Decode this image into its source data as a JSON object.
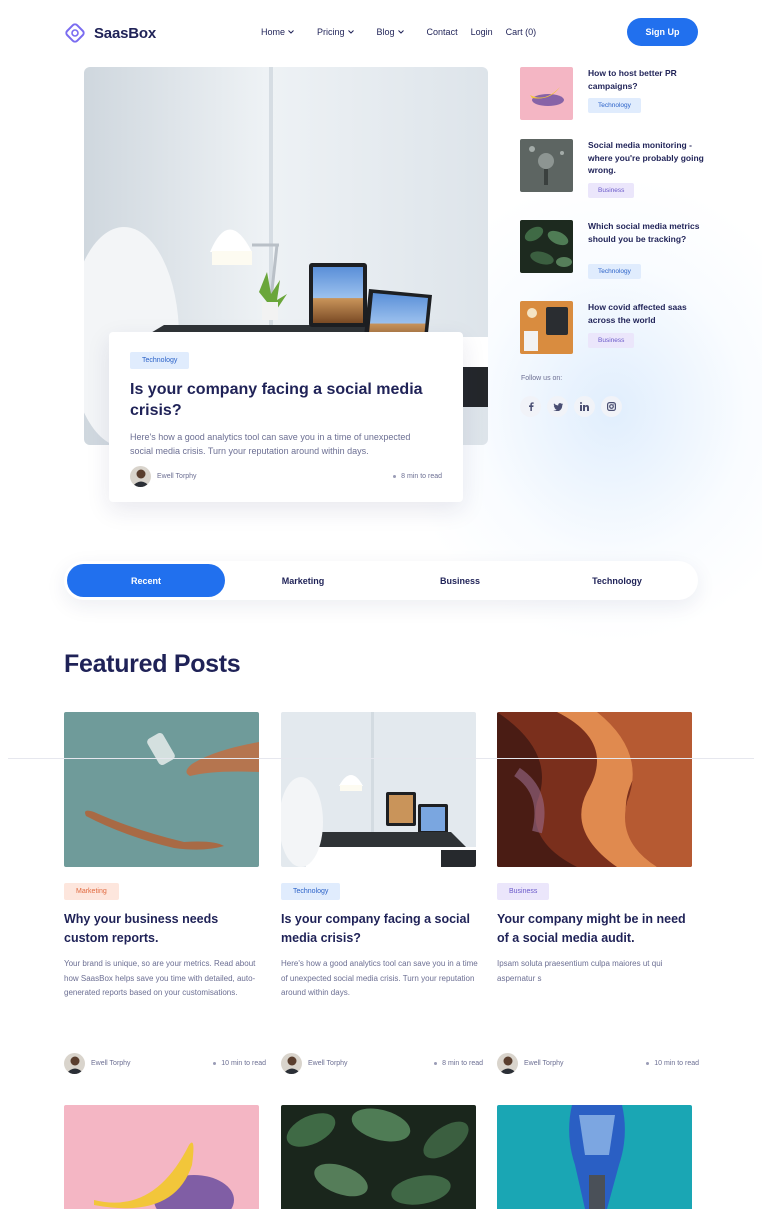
{
  "brand": {
    "name": "SaasBox",
    "accent": "#2170ee",
    "ink": "#1f2257"
  },
  "nav": {
    "items": [
      {
        "label": "Home",
        "has_dropdown": true
      },
      {
        "label": "Pricing",
        "has_dropdown": true
      },
      {
        "label": "Blog",
        "has_dropdown": true
      },
      {
        "label": "Contact",
        "has_dropdown": false
      },
      {
        "label": "Login",
        "has_dropdown": false
      },
      {
        "label": "Cart (0)",
        "has_dropdown": false
      }
    ],
    "cta": "Sign Up"
  },
  "hero": {
    "tag": "Technology",
    "title": "Is your company facing a social media crisis?",
    "description": "Here's how a good analytics tool can save you in a time of unexpected social media crisis. Turn your reputation around within days.",
    "author": "Ewell Torphy",
    "read_time": "8 min to read"
  },
  "sidebar": {
    "posts": [
      {
        "title": "How to host better PR campaigns?",
        "tag": "Technology",
        "tag_kind": "tech"
      },
      {
        "title": "Social media monitoring - where you're probably going wrong.",
        "tag": "Business",
        "tag_kind": "biz"
      },
      {
        "title": "Which social media metrics should you be tracking?",
        "tag": "Technology",
        "tag_kind": "tech"
      },
      {
        "title": "How covid affected saas across the world",
        "tag": "Business",
        "tag_kind": "biz"
      }
    ],
    "follow_label": "Follow us on:",
    "socials": [
      "facebook-icon",
      "twitter-icon",
      "linkedin-icon",
      "instagram-icon"
    ]
  },
  "tabs": {
    "items": [
      "Recent",
      "Marketing",
      "Business",
      "Technology"
    ],
    "active": "Recent"
  },
  "featured": {
    "title": "Featured Posts",
    "posts": [
      {
        "tag": "Marketing",
        "title": "Why your business needs custom reports.",
        "description": "Your brand is unique, so are your metrics. Read about how SaasBox helps save you time with detailed, auto-generated reports based on your customisations.",
        "author": "Ewell Torphy",
        "read_time": "10 min to read"
      },
      {
        "tag": "Technology",
        "title": "Is your company facing a social media crisis?",
        "description": "Here's how a good analytics tool can save you in a time of unexpected social media crisis. Turn your reputation around within days.",
        "author": "Ewell Torphy",
        "read_time": "8 min to read"
      },
      {
        "tag": "Business",
        "title": "Your company might be in need of a social media audit.",
        "description": "Ipsam soluta praesentium culpa maiores ut qui aspernatur s",
        "author": "Ewell Torphy",
        "read_time": "10 min to read"
      }
    ]
  }
}
